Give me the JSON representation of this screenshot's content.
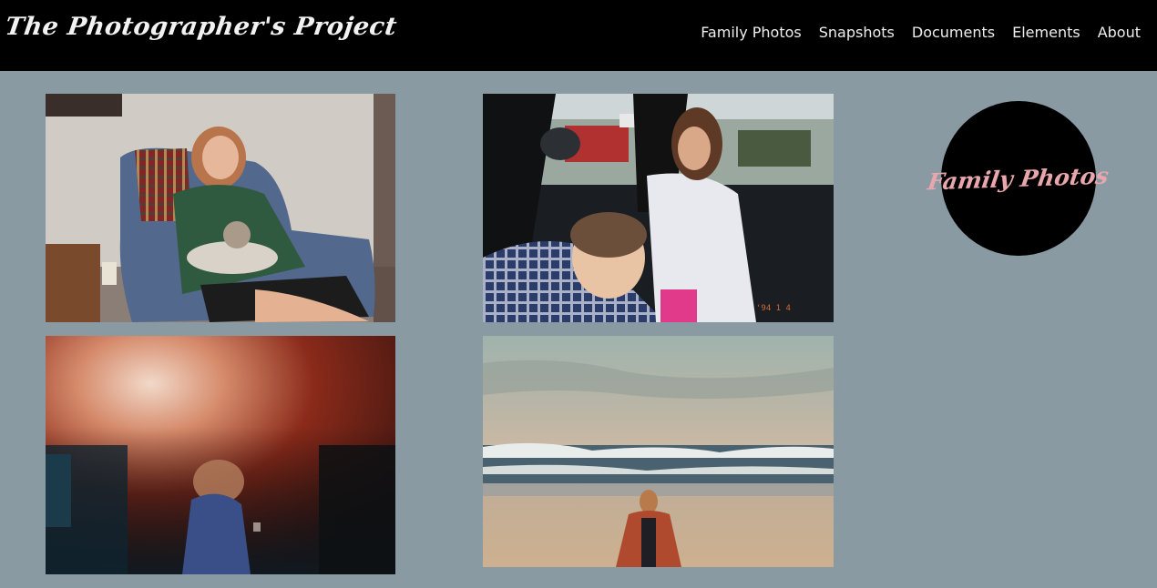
{
  "header": {
    "site_title": "The Photographer's Project",
    "nav": [
      "Family Photos",
      "Snapshots",
      "Documents",
      "Elements",
      "About"
    ]
  },
  "gallery": {
    "photos": [
      {
        "subject": "woman-with-cat-in-armchair"
      },
      {
        "subject": "children-in-car"
      },
      {
        "subject": "light-leak-girl-in-dress"
      },
      {
        "subject": "girl-on-beach"
      }
    ],
    "photo_date_stamp": "'94 1 4"
  },
  "badge": {
    "label": "Family Photos"
  },
  "colors": {
    "background": "#8a9aa3",
    "header": "#000000",
    "badge_text": "#e8a6ad"
  }
}
